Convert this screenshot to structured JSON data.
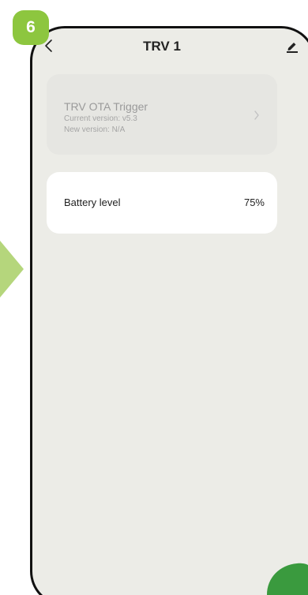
{
  "step_badge": "6",
  "header": {
    "title": "TRV 1",
    "back_icon": "chevron-left-icon",
    "edit_icon": "pencil-icon"
  },
  "ota_card": {
    "title": "TRV OTA Trigger",
    "current_version": "Current version: v5.3",
    "new_version": "New version: N/A",
    "disabled": true
  },
  "battery_card": {
    "label": "Battery level",
    "value": "75%"
  },
  "colors": {
    "accent_green": "#8dc63f",
    "badge_green": "#8dc63f",
    "arrow_green": "#b5d67c",
    "screen_background": "#ecece7",
    "card_background": "#ffffff",
    "disabled_card_background": "#e6e6e2"
  }
}
